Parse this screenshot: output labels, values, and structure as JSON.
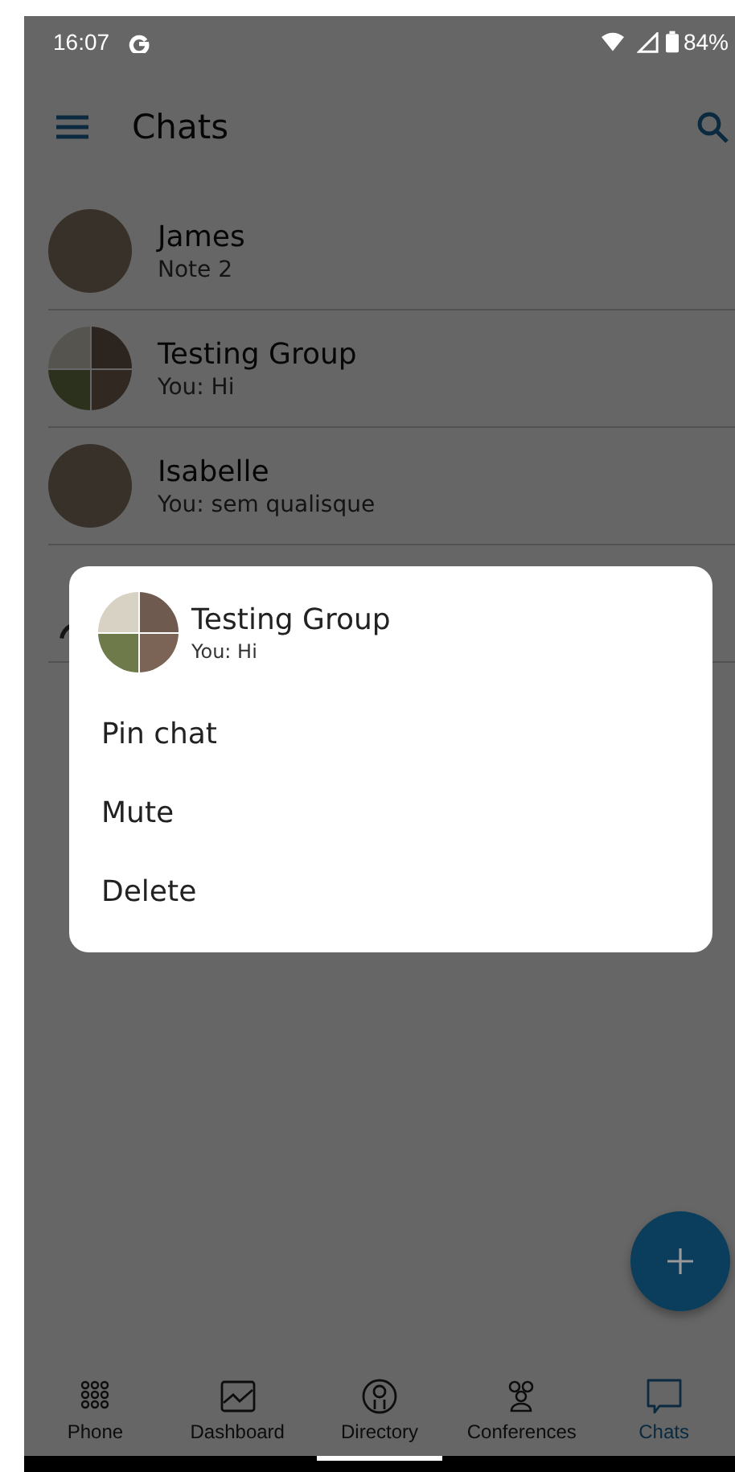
{
  "status_bar": {
    "time": "16:07",
    "battery": "84%"
  },
  "app_bar": {
    "title": "Chats"
  },
  "chats": [
    {
      "kind": "photo",
      "name": "James",
      "preview": "Note 2"
    },
    {
      "kind": "group",
      "name": "Testing Group",
      "preview": "You: Hi"
    },
    {
      "kind": "photo",
      "name": "Isabelle",
      "preview": "You: sem qualisque"
    },
    {
      "kind": "silhouette"
    }
  ],
  "dialog": {
    "title": "Testing Group",
    "subtitle": "You: Hi",
    "actions": [
      "Pin chat",
      "Mute",
      "Delete"
    ]
  },
  "bottom_nav": [
    {
      "kind": "dialpad",
      "label": "Phone",
      "selected": false
    },
    {
      "kind": "chart",
      "label": "Dashboard",
      "selected": false
    },
    {
      "kind": "person",
      "label": "Directory",
      "selected": false
    },
    {
      "kind": "people",
      "label": "Conferences",
      "selected": false
    },
    {
      "kind": "chat",
      "label": "Chats",
      "selected": true
    }
  ]
}
